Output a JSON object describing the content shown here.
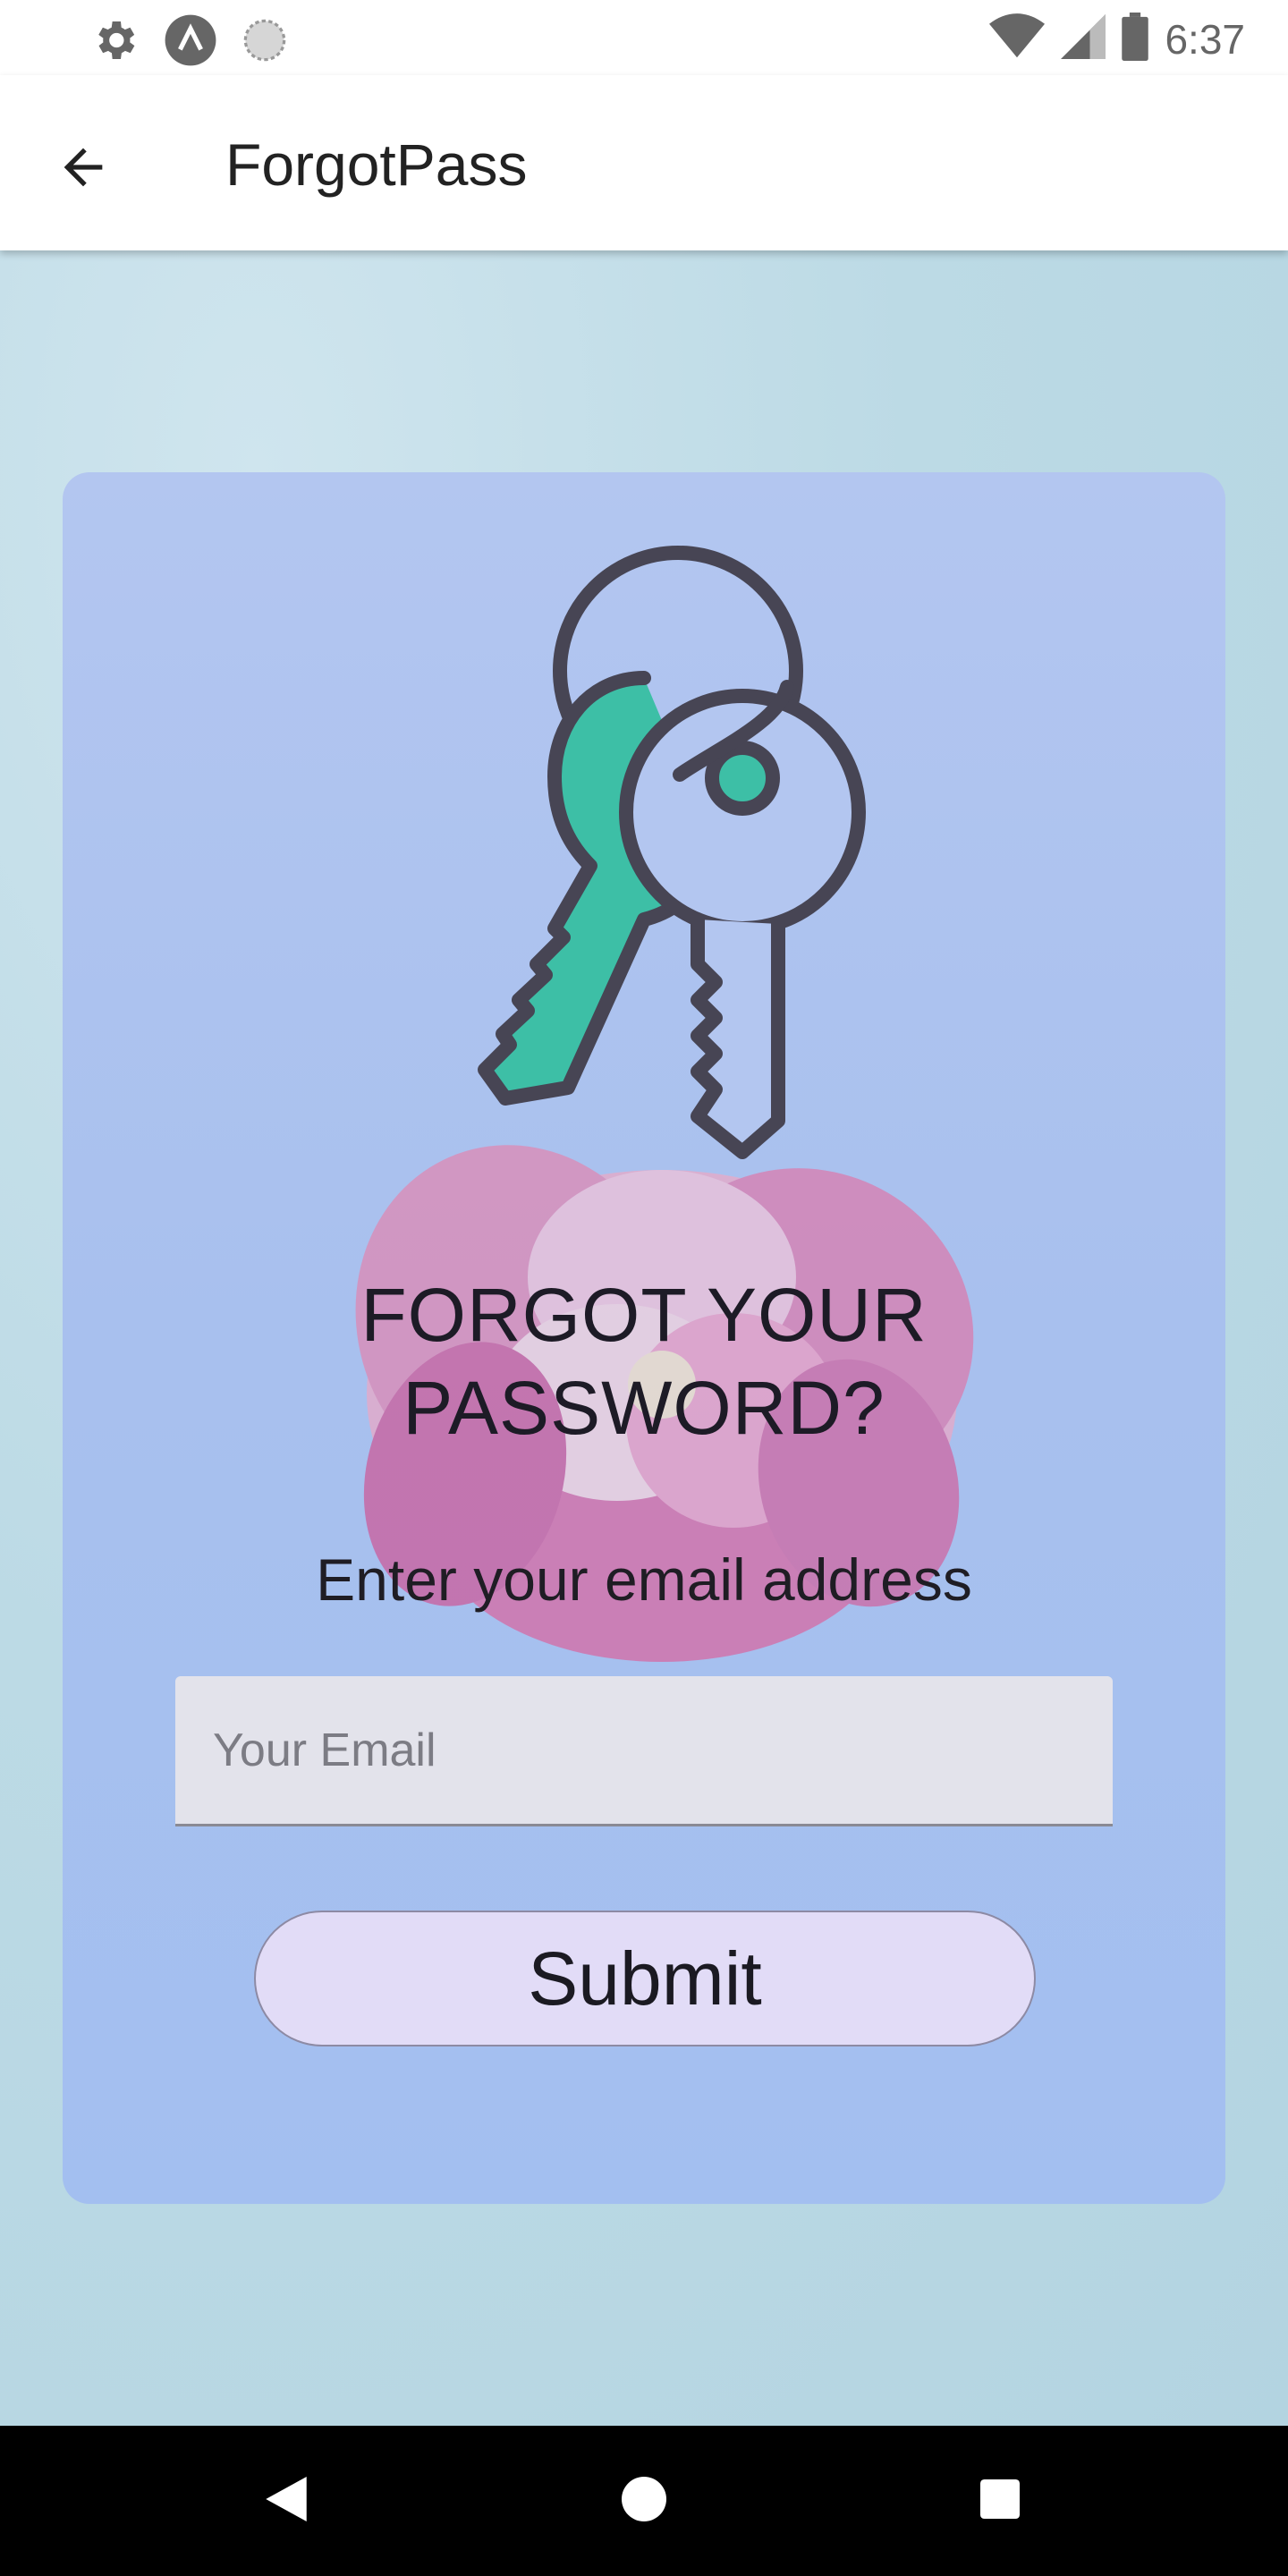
{
  "status_bar": {
    "time": "6:37",
    "left_icons": [
      "settings-icon",
      "app-notification-icon",
      "sync-icon"
    ],
    "right_icons": [
      "wifi-icon",
      "signal-icon",
      "battery-icon"
    ]
  },
  "app_bar": {
    "title": "ForgotPass",
    "back_icon": "arrow-back-icon"
  },
  "form": {
    "heading_line1": "FORGOT YOUR",
    "heading_line2": "PASSWORD?",
    "subheading": "Enter your email address",
    "email_placeholder": "Your Email",
    "email_value": "",
    "submit_label": "Submit"
  },
  "nav_bar": {
    "buttons": [
      "back-triangle-icon",
      "home-circle-icon",
      "recents-square-icon"
    ]
  },
  "colors": {
    "key_accent": "#3dbfa6",
    "key_outline": "#474554",
    "card_bg": "#aec4ef",
    "button_bg": "#e2dcf7"
  }
}
